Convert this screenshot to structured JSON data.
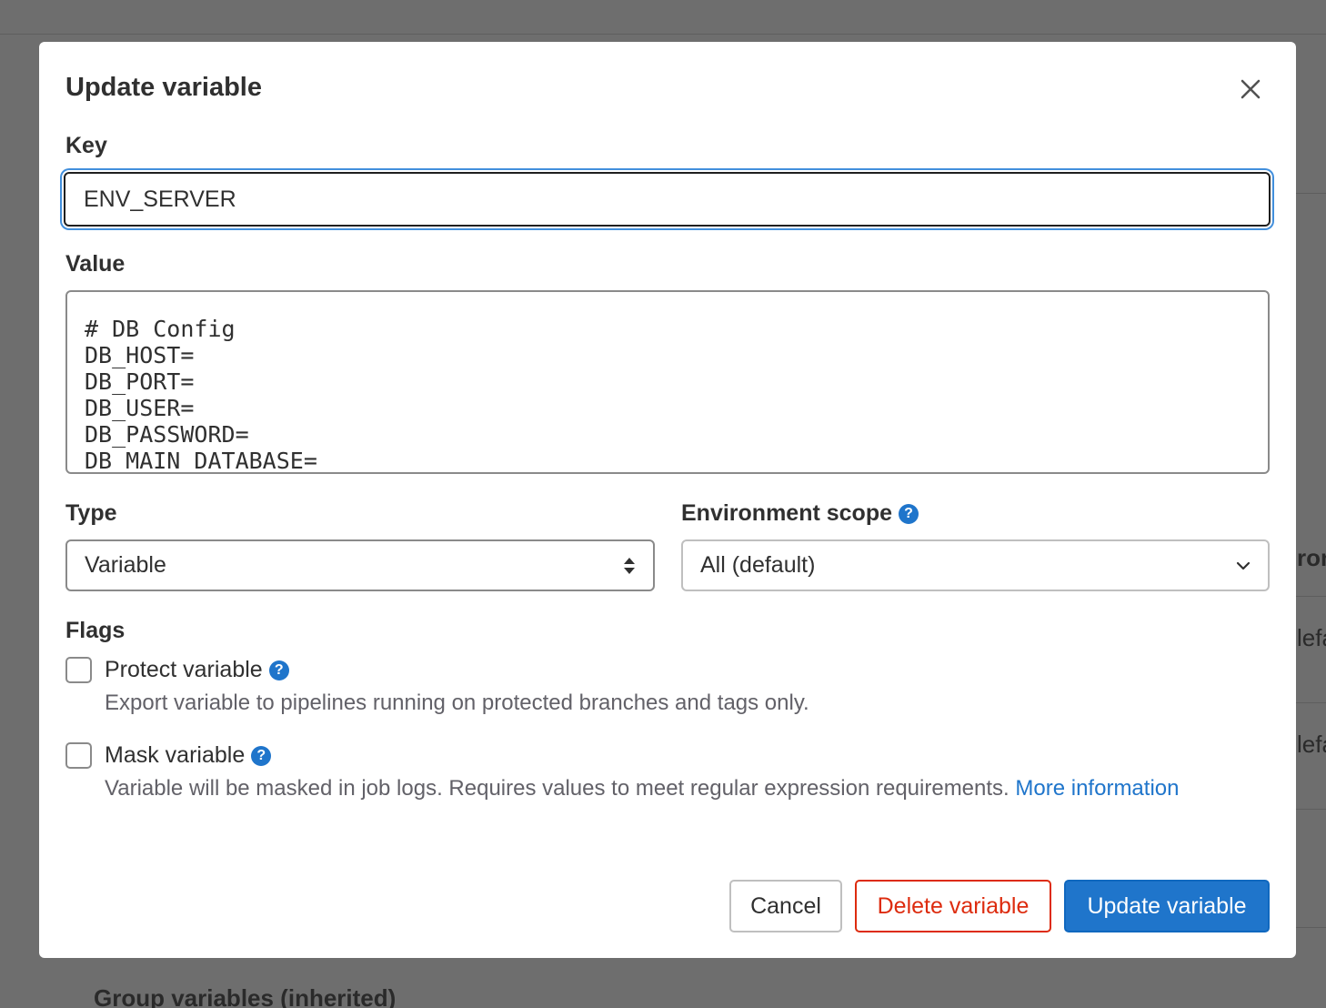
{
  "background": {
    "footer_heading": "Group variables (inherited)",
    "right_fragments": [
      "ron",
      "lefa",
      "lefa"
    ]
  },
  "modal": {
    "title": "Update variable",
    "close_icon": "close-icon",
    "key": {
      "label": "Key",
      "value": "ENV_SERVER"
    },
    "value_field": {
      "label": "Value",
      "lines": [
        "# DB Config",
        "DB_HOST=",
        "DB_PORT=",
        "DB_USER=",
        "DB_PASSWORD=",
        "DB_MAIN_DATABASE="
      ]
    },
    "type": {
      "label": "Type",
      "selected": "Variable",
      "icon": "sort-arrows-icon"
    },
    "environment_scope": {
      "label": "Environment scope",
      "selected": "All (default)",
      "icon": "chevron-down-icon"
    },
    "flags": {
      "label": "Flags",
      "protect": {
        "label": "Protect variable",
        "checked": false,
        "help": "Export variable to pipelines running on protected branches and tags only."
      },
      "mask": {
        "label": "Mask variable",
        "checked": false,
        "help": "Variable will be masked in job logs. Requires values to meet regular expression requirements.",
        "link_text_1": "More",
        "link_text_2": "information"
      }
    },
    "buttons": {
      "cancel": "Cancel",
      "delete": "Delete variable",
      "update": "Update variable"
    },
    "colors": {
      "primary": "#1f75cb",
      "danger": "#dd2b0e",
      "focus_ring": "#428fdc"
    }
  }
}
